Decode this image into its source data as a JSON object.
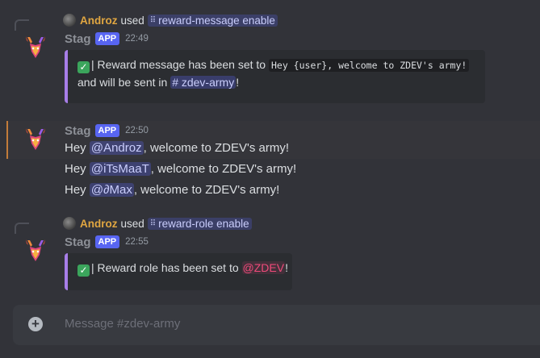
{
  "messages": [
    {
      "command": {
        "user": "Androz",
        "used": "used",
        "name": "reward-message enable"
      },
      "bot": {
        "name": "Stag",
        "tag": "APP",
        "time": "22:49"
      },
      "embed": {
        "check": "✓",
        "text_before": "| Reward message has been set to ",
        "code": "Hey {user}, welcome to ZDEV's army!",
        "text_mid": "and will be sent in ",
        "channel": "# zdev-army",
        "text_end": "!"
      }
    },
    {
      "bot": {
        "name": "Stag",
        "tag": "APP",
        "time": "22:50"
      },
      "lines": [
        {
          "prefix": "Hey ",
          "mention": "@Androz",
          "suffix": ", welcome to ZDEV's army!"
        },
        {
          "prefix": "Hey ",
          "mention": "@iTsMaaT",
          "suffix": ", welcome to ZDEV's army!"
        },
        {
          "prefix": "Hey ",
          "mention": "@∂Max",
          "suffix": ", welcome to ZDEV's army!"
        }
      ]
    },
    {
      "command": {
        "user": "Androz",
        "used": "used",
        "name": "reward-role enable"
      },
      "bot": {
        "name": "Stag",
        "tag": "APP",
        "time": "22:55"
      },
      "embed": {
        "check": "✓",
        "text_before": "| Reward role has been set to ",
        "role": "@ZDEV",
        "text_end": "!"
      }
    }
  ],
  "composer": {
    "placeholder": "Message #zdev-army",
    "plus_icon": "+"
  },
  "colors": {
    "background": "#323339",
    "embed_border": "#a77ee8",
    "app_tag": "#5865f2",
    "command_user": "#e0a641",
    "role_mention": "#f04a7a"
  }
}
